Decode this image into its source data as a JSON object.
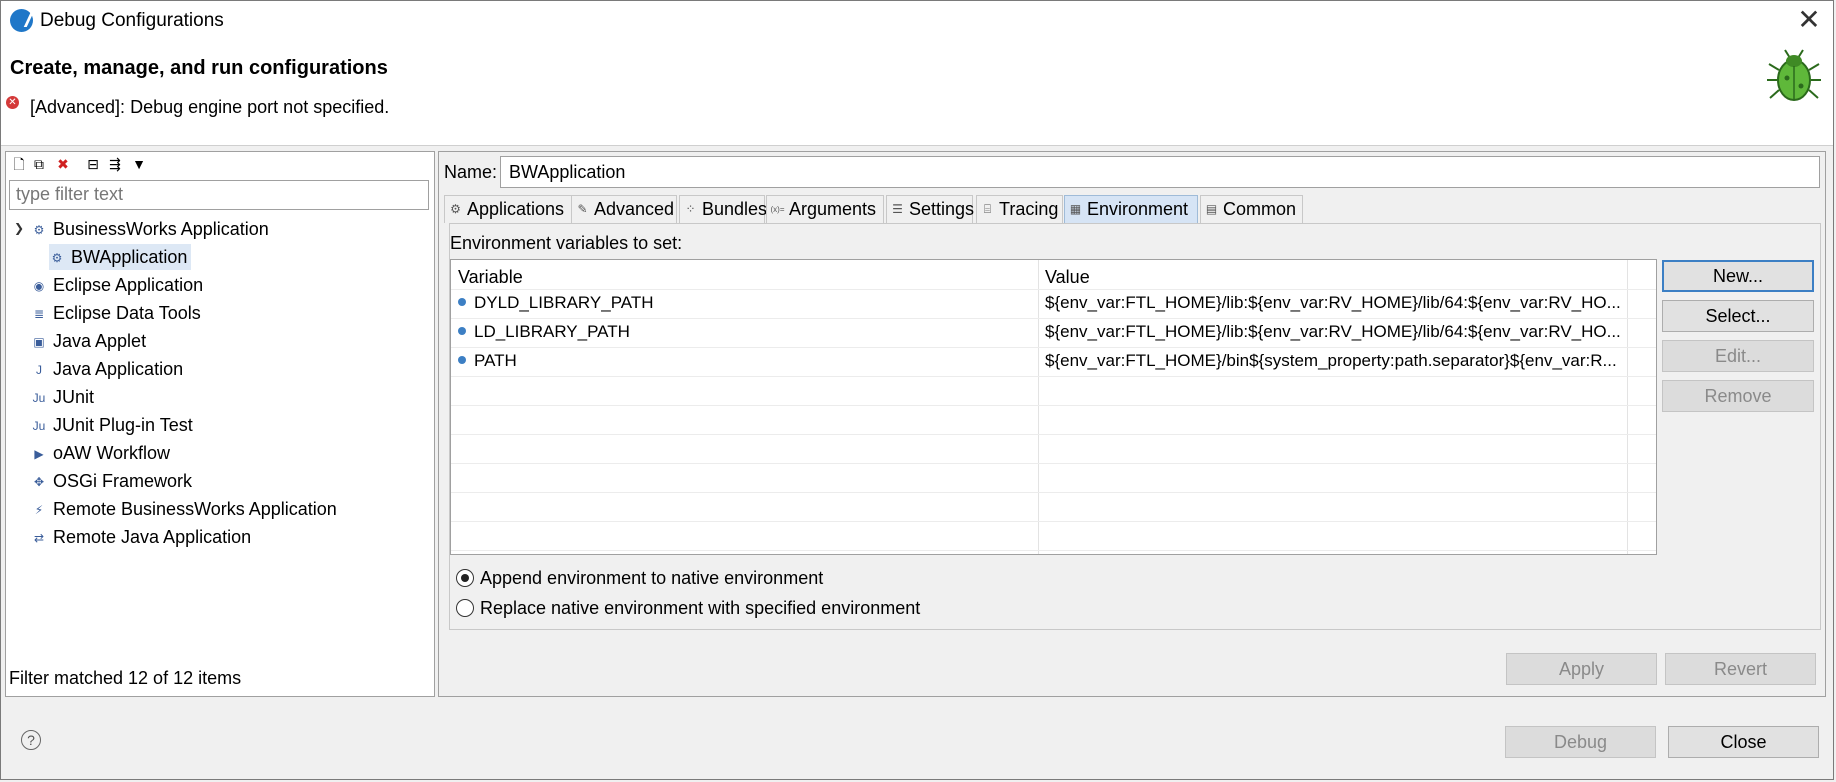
{
  "window": {
    "title": "Debug Configurations",
    "close_glyph": "✕"
  },
  "header": {
    "title": "Create, manage, and run configurations",
    "error_message": "[Advanced]: Debug engine port not specified."
  },
  "left": {
    "toolbar": [
      {
        "name": "new-config-icon",
        "glyph": "🗋"
      },
      {
        "name": "duplicate-config-icon",
        "glyph": "⧉"
      },
      {
        "name": "delete-config-icon",
        "glyph": "✖"
      },
      {
        "name": "collapse-all-icon",
        "glyph": "⊟"
      },
      {
        "name": "filter-config-icon",
        "glyph": "⇶"
      },
      {
        "name": "view-menu-icon",
        "glyph": "▼"
      }
    ],
    "filter_placeholder": "type filter text",
    "tree": [
      {
        "label": "BusinessWorks Application",
        "icon": "bw-app-icon",
        "glyph": "⚙",
        "indent": 0,
        "expanded": true
      },
      {
        "label": "BWApplication",
        "icon": "bw-config-icon",
        "glyph": "⚙",
        "indent": 1,
        "selected": true
      },
      {
        "label": "Eclipse Application",
        "icon": "eclipse-icon",
        "glyph": "◉",
        "indent": 0
      },
      {
        "label": "Eclipse Data Tools",
        "icon": "database-icon",
        "glyph": "≣",
        "indent": 0
      },
      {
        "label": "Java Applet",
        "icon": "applet-icon",
        "glyph": "▣",
        "indent": 0
      },
      {
        "label": "Java Application",
        "icon": "java-app-icon",
        "glyph": "J",
        "indent": 0
      },
      {
        "label": "JUnit",
        "icon": "junit-icon",
        "glyph": "Ju",
        "indent": 0
      },
      {
        "label": "JUnit Plug-in Test",
        "icon": "junit-plugin-icon",
        "glyph": "Ju",
        "indent": 0
      },
      {
        "label": "oAW Workflow",
        "icon": "workflow-icon",
        "glyph": "▶",
        "indent": 0
      },
      {
        "label": "OSGi Framework",
        "icon": "osgi-icon",
        "glyph": "✥",
        "indent": 0
      },
      {
        "label": "Remote BusinessWorks Application",
        "icon": "remote-bw-icon",
        "glyph": "⚡",
        "indent": 0
      },
      {
        "label": "Remote Java Application",
        "icon": "remote-java-icon",
        "glyph": "⇄",
        "indent": 0
      }
    ],
    "filter_status": "Filter matched 12 of 12 items"
  },
  "right": {
    "name_label": "Name:",
    "name_value": "BWApplication",
    "tabs": [
      {
        "label": "Applications",
        "icon": "applications-tab-icon",
        "glyph": "⚙"
      },
      {
        "label": "Advanced",
        "icon": "advanced-tab-icon",
        "glyph": "✎"
      },
      {
        "label": "Bundles",
        "icon": "bundles-tab-icon",
        "glyph": "⁘"
      },
      {
        "label": "Arguments",
        "icon": "arguments-tab-icon",
        "glyph": "(x)="
      },
      {
        "label": "Settings",
        "icon": "settings-tab-icon",
        "glyph": "☰"
      },
      {
        "label": "Tracing",
        "icon": "tracing-tab-icon",
        "glyph": "⌸"
      },
      {
        "label": "Environment",
        "icon": "environment-tab-icon",
        "glyph": "▦",
        "active": true
      },
      {
        "label": "Common",
        "icon": "common-tab-icon",
        "glyph": "▤"
      }
    ],
    "env_label": "Environment variables to set:",
    "table": {
      "columns": [
        "Variable",
        "Value"
      ],
      "rows": [
        {
          "variable": "DYLD_LIBRARY_PATH",
          "value": "${env_var:FTL_HOME}/lib:${env_var:RV_HOME}/lib/64:${env_var:RV_HO..."
        },
        {
          "variable": "LD_LIBRARY_PATH",
          "value": "${env_var:FTL_HOME}/lib:${env_var:RV_HOME}/lib/64:${env_var:RV_HO..."
        },
        {
          "variable": "PATH",
          "value": "${env_var:FTL_HOME}/bin${system_property:path.separator}${env_var:R..."
        }
      ]
    },
    "side_buttons": {
      "new": "New...",
      "select": "Select...",
      "edit": "Edit...",
      "remove": "Remove"
    },
    "radio": {
      "append": "Append environment to native environment",
      "replace": "Replace native environment with specified environment",
      "selected": "append"
    },
    "apply": "Apply",
    "revert": "Revert"
  },
  "footer": {
    "help_glyph": "?",
    "debug": "Debug",
    "close": "Close"
  }
}
